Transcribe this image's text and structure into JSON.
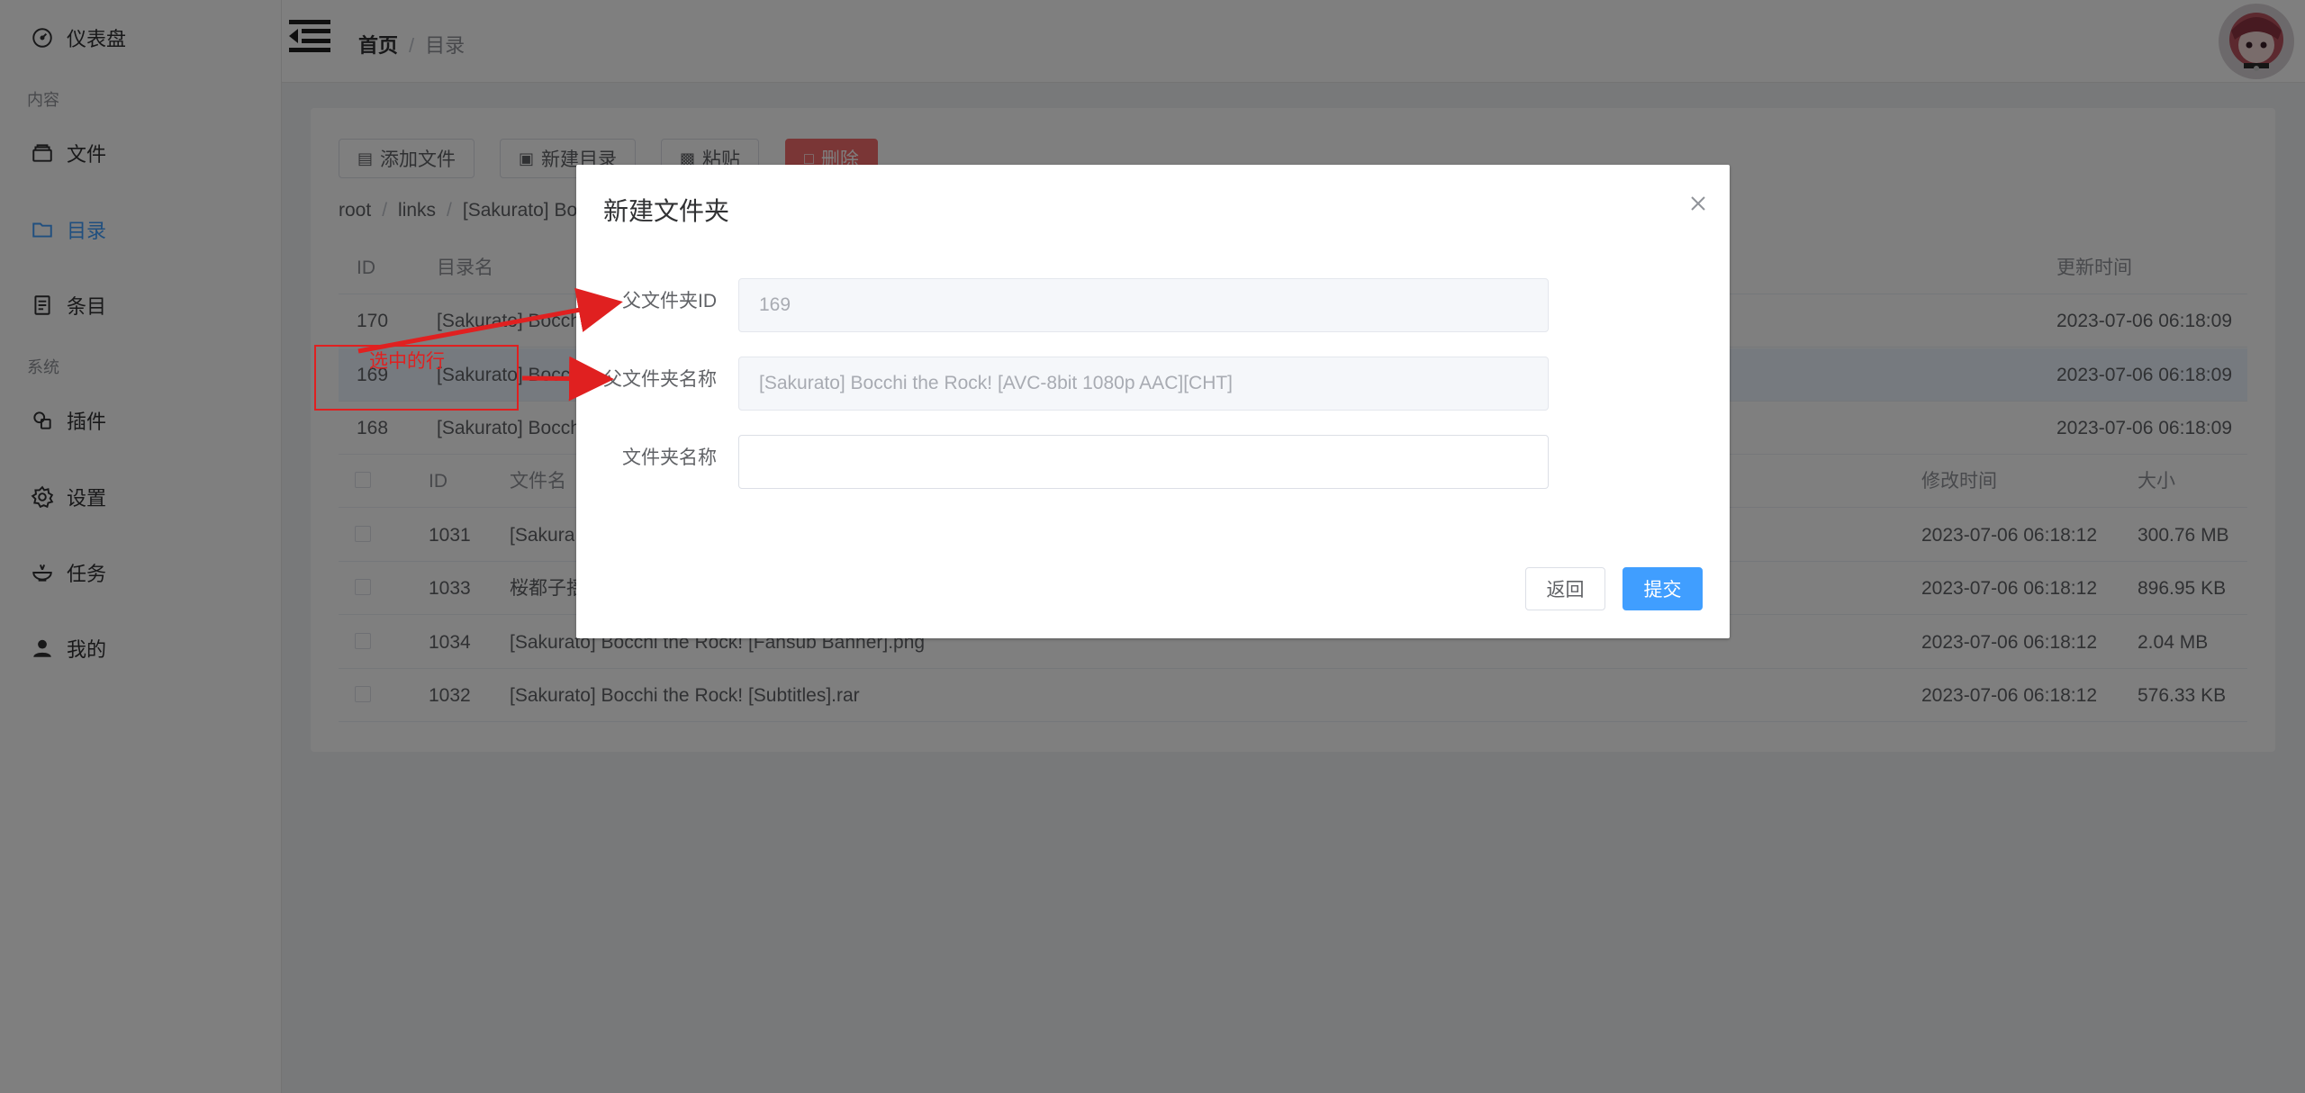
{
  "sidebar": {
    "dashboard": "仪表盘",
    "group_content": "内容",
    "files": "文件",
    "directories": "目录",
    "entries": "条目",
    "group_system": "系统",
    "plugins": "插件",
    "settings": "设置",
    "tasks": "任务",
    "mine": "我的"
  },
  "header": {
    "breadcrumb_home": "首页",
    "breadcrumb_sep": "/",
    "breadcrumb_current": "目录"
  },
  "toolbar": {
    "add_file": "添加文件",
    "new_dir": "新建目录",
    "paste": "粘贴",
    "delete": "删除"
  },
  "path": {
    "parts": [
      "root",
      "links",
      "[Sakurato] Bo"
    ],
    "sep": "/"
  },
  "dir_table": {
    "headers": {
      "id": "ID",
      "name": "目录名",
      "updated": "更新时间"
    },
    "rows": [
      {
        "id": "170",
        "name": "[Sakurato] Bocch",
        "updated": "2023-07-06 06:18:09"
      },
      {
        "id": "169",
        "name": "[Sakurato] Bocch",
        "updated": "2023-07-06 06:18:09"
      },
      {
        "id": "168",
        "name": "[Sakurato] Bocch",
        "updated": "2023-07-06 06:18:09"
      }
    ]
  },
  "file_table": {
    "headers": {
      "id": "ID",
      "name": "文件名",
      "modified": "修改时间",
      "size": "大小"
    },
    "rows": [
      {
        "id": "1031",
        "name": "[Sakura",
        "modified": "2023-07-06 06:18:12",
        "size": "300.76 MB"
      },
      {
        "id": "1033",
        "name": "桜都子揺",
        "modified": "2023-07-06 06:18:12",
        "size": "896.95 KB"
      },
      {
        "id": "1034",
        "name": "[Sakurato] Bocchi the Rock! [Fansub Banner].png",
        "modified": "2023-07-06 06:18:12",
        "size": "2.04 MB"
      },
      {
        "id": "1032",
        "name": "[Sakurato] Bocchi the Rock! [Subtitles].rar",
        "modified": "2023-07-06 06:18:12",
        "size": "576.33 KB"
      }
    ]
  },
  "dialog": {
    "title": "新建文件夹",
    "parent_id_label": "父文件夹ID",
    "parent_id_value": "169",
    "parent_name_label": "父文件夹名称",
    "parent_name_value": "[Sakurato] Bocchi the Rock! [AVC-8bit 1080p AAC][CHT]",
    "folder_name_label": "文件夹名称",
    "folder_name_value": "",
    "back_button": "返回",
    "submit_button": "提交"
  },
  "annotation": {
    "text": "选中的行",
    "color": "#e02020"
  },
  "colors": {
    "accent": "#409eff",
    "danger": "#f56c6c"
  }
}
